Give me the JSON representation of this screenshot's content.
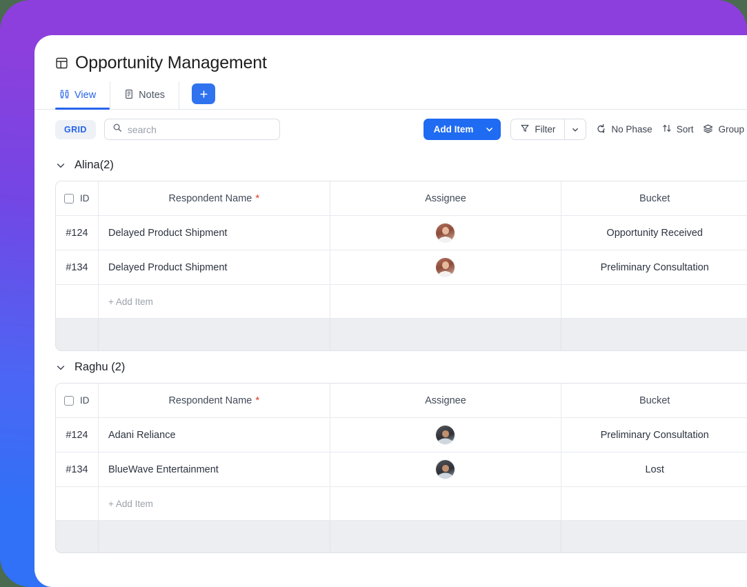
{
  "app": {
    "title": "Opportunity Management",
    "title_icon": "layout-grid-icon"
  },
  "tabs": [
    {
      "label": "View",
      "icon": "view-columns-icon",
      "active": true
    },
    {
      "label": "Notes",
      "icon": "document-icon",
      "active": false
    }
  ],
  "tab_add_label": "+",
  "toolbar": {
    "grid_chip": "GRID",
    "search_placeholder": "search",
    "search_value": "",
    "add_item_label": "Add Item",
    "filter_label": "Filter",
    "phase_label": "No Phase",
    "sort_label": "Sort",
    "group_label": "Group",
    "more_label": "…"
  },
  "columns": {
    "id": "ID",
    "name": "Respondent Name",
    "name_required": "*",
    "assignee": "Assignee",
    "bucket": "Bucket"
  },
  "add_row_label": "+ Add Item",
  "groups": [
    {
      "title": "Alina(2)",
      "rows": [
        {
          "id": "#124",
          "name": "Delayed Product Shipment",
          "assignee": "female",
          "bucket": "Opportunity Received"
        },
        {
          "id": "#134",
          "name": "Delayed Product Shipment",
          "assignee": "female",
          "bucket": "Preliminary Consultation"
        }
      ]
    },
    {
      "title": "Raghu (2)",
      "rows": [
        {
          "id": "#124",
          "name": "Adani Reliance",
          "assignee": "male",
          "bucket": "Preliminary Consultation"
        },
        {
          "id": "#134",
          "name": "BlueWave Entertainment",
          "assignee": "male",
          "bucket": "Lost"
        }
      ]
    }
  ],
  "colors": {
    "accent_blue": "#1f6bf2",
    "tab_active": "#2563eb",
    "required_red": "#d83c2f",
    "gradient_top": "#8c3fdc",
    "gradient_bottom": "#3071f7",
    "backdrop": "#4a6b4f",
    "footer_row": "#eceef1"
  }
}
